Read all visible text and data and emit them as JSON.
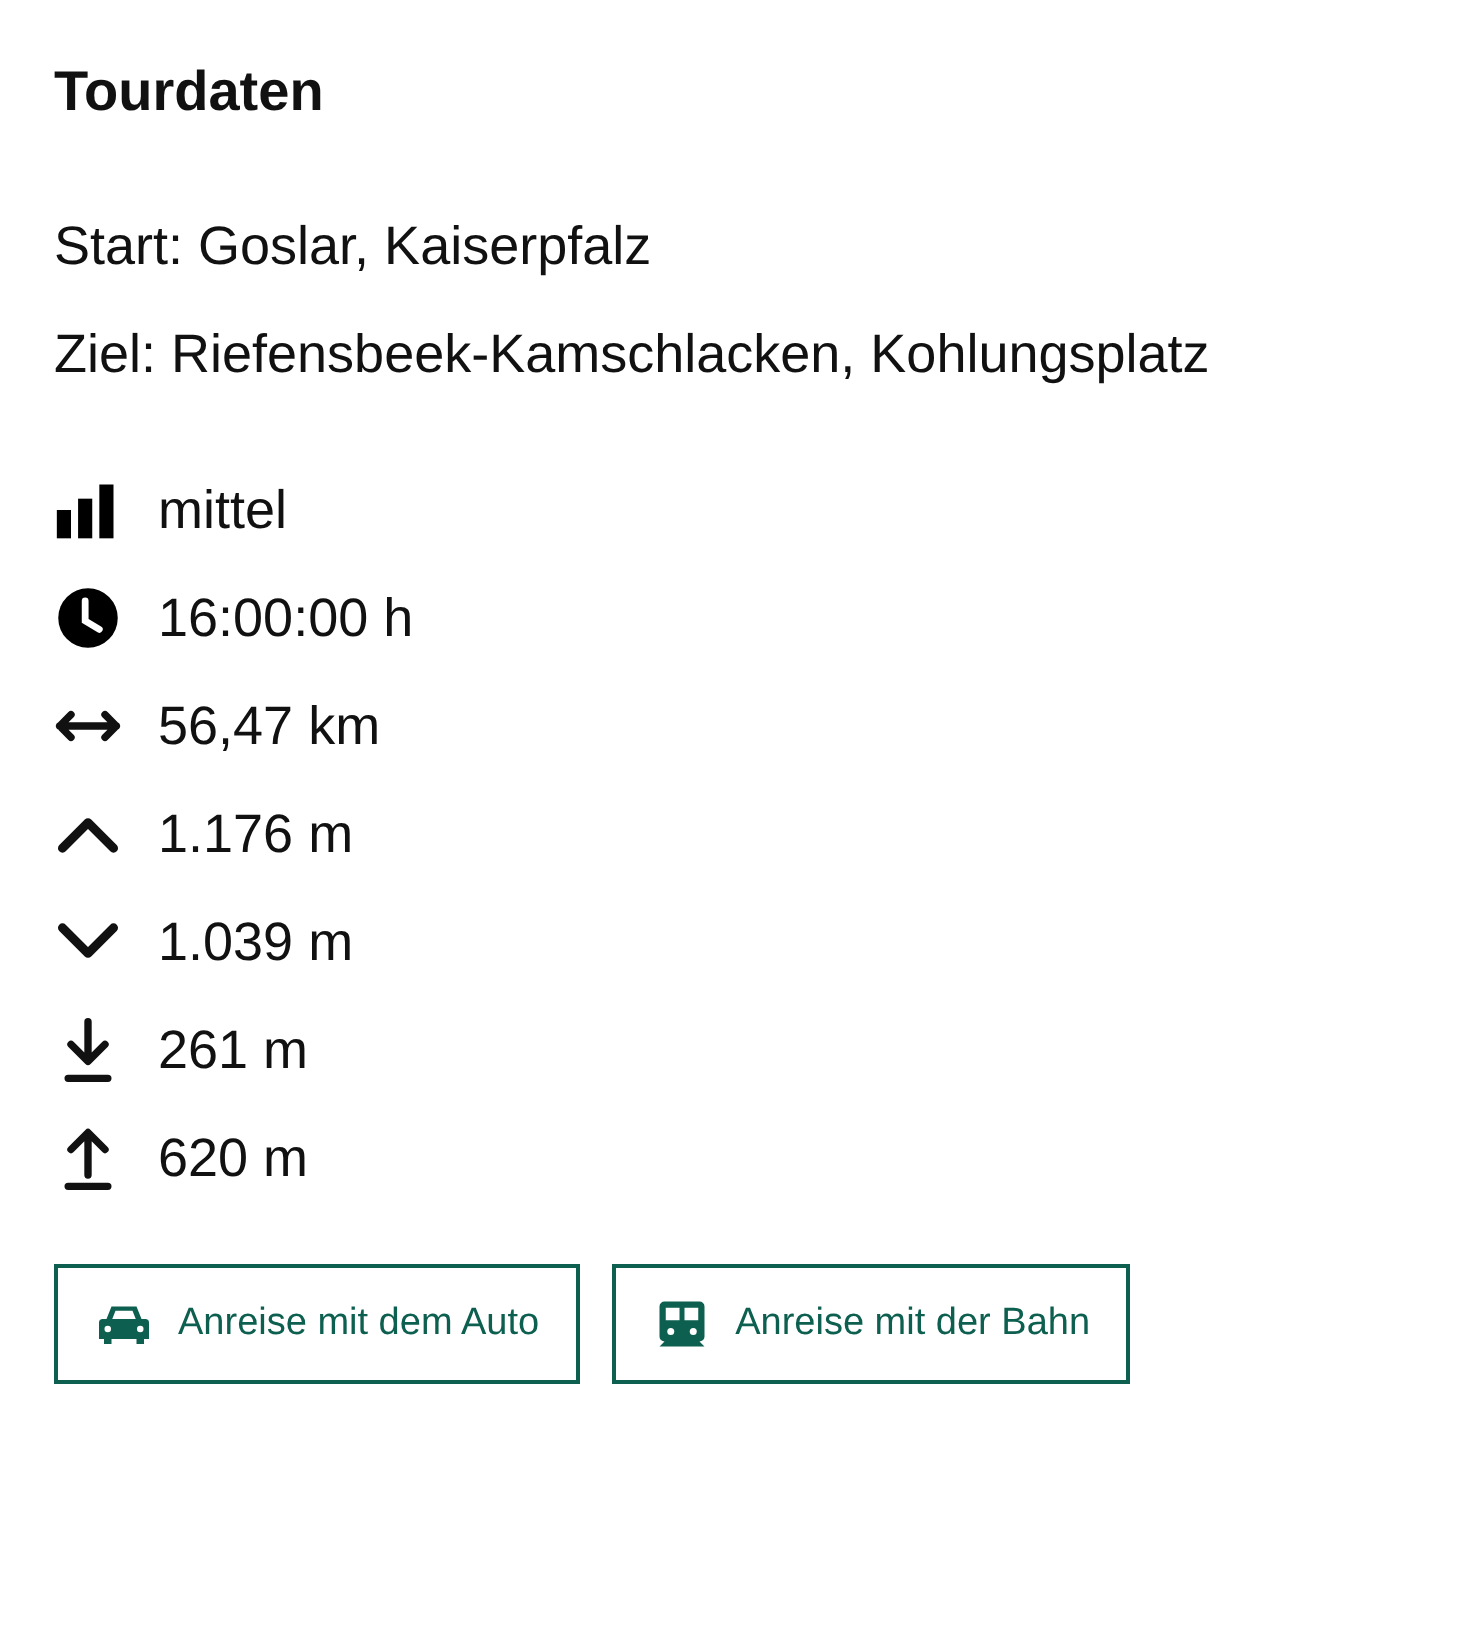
{
  "title": "Tourdaten",
  "route": {
    "start": "Start: Goslar, Kaiserpfalz",
    "ziel": "Ziel: Riefensbeek-Kamschlacken, Kohlungsplatz"
  },
  "stats": [
    {
      "kind": "difficulty",
      "text": "mittel"
    },
    {
      "kind": "duration",
      "text": "16:00:00 h"
    },
    {
      "kind": "distance",
      "text": "56,47 km"
    },
    {
      "kind": "ascent",
      "text": "1.176 m"
    },
    {
      "kind": "descent",
      "text": "1.039 m"
    },
    {
      "kind": "lowest",
      "text": "261 m"
    },
    {
      "kind": "highest",
      "text": "620 m"
    }
  ],
  "buttons": [
    {
      "kind": "car",
      "label": "Anreise mit dem Auto"
    },
    {
      "kind": "train",
      "label": "Anreise mit der Bahn"
    }
  ]
}
